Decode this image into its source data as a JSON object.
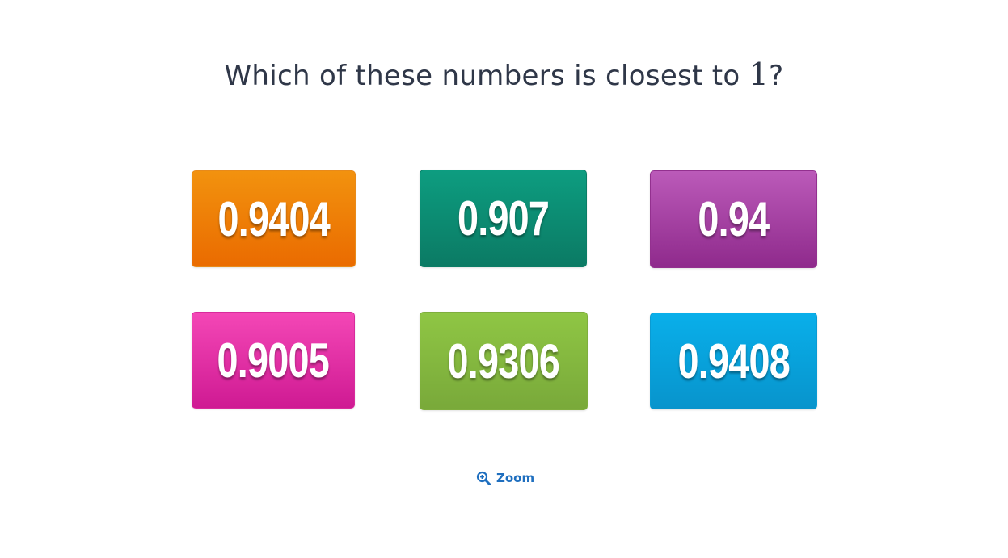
{
  "question": {
    "prefix": "Which of these numbers is closest to ",
    "number": "1",
    "suffix": "?"
  },
  "options": [
    {
      "label": "0.9404",
      "color": "#ee7d06"
    },
    {
      "label": "0.907",
      "color": "#0c8b72"
    },
    {
      "label": "0.94",
      "color": "#a4409f"
    },
    {
      "label": "0.9005",
      "color": "#e32ea6"
    },
    {
      "label": "0.9306",
      "color": "#85b83f"
    },
    {
      "label": "0.9408",
      "color": "#08a2dc"
    }
  ],
  "zoom": {
    "label": "Zoom",
    "icon": "zoom-in-icon",
    "color": "#1f6fbf"
  }
}
